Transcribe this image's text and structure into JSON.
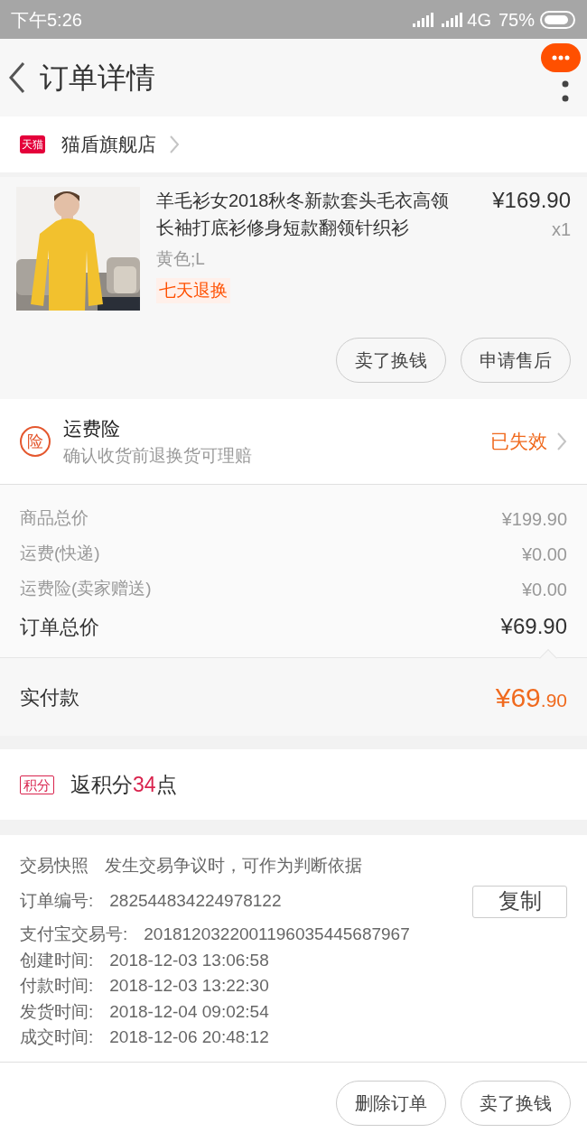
{
  "status_bar": {
    "time": "下午5:26",
    "network": "4G",
    "battery": "75%"
  },
  "header": {
    "title": "订单详情"
  },
  "shop": {
    "badge": "天猫",
    "name": "猫盾旗舰店"
  },
  "product": {
    "kind": "picture",
    "title": "羊毛衫女2018秋冬新款套头毛衣高领长袖打底衫修身短款翻领针织衫",
    "price": "¥169.90",
    "quantity": "x1",
    "sku": "黄色;L",
    "tag": "七天退换",
    "buttons": [
      "卖了换钱",
      "申请售后"
    ]
  },
  "insurance": {
    "icon_text": "险",
    "title": "运费险",
    "subtitle": "确认收货前退换货可理赔",
    "status": "已失效"
  },
  "price_rows": [
    {
      "kind": "minor",
      "label": "商品总价",
      "value": "¥199.90"
    },
    {
      "kind": "minor",
      "label": "运费(快递)",
      "value": "¥0.00"
    },
    {
      "kind": "minor",
      "label": "运费险(卖家赠送)",
      "value": "¥0.00"
    },
    {
      "kind": "total",
      "label": "订单总价",
      "value": "¥69.90"
    }
  ],
  "paid": {
    "label": "实付款",
    "value_main": "¥69",
    "value_decimal": ".90"
  },
  "points": {
    "badge": "积分",
    "text_before": "返积分",
    "amount": "34",
    "text_after": "点"
  },
  "order_info": {
    "snapshot_label": "交易快照",
    "snapshot_note": "发生交易争议时，可作为判断依据",
    "copy_button": "复制",
    "rows": [
      {
        "label": "订单编号:",
        "value": "282544834224978122"
      },
      {
        "label": "支付宝交易号:",
        "value": "2018120322001196035445687967"
      },
      {
        "label": "创建时间:",
        "value": "2018-12-03 13:06:58"
      },
      {
        "label": "付款时间:",
        "value": "2018-12-03 13:22:30"
      },
      {
        "label": "发货时间:",
        "value": "2018-12-04 09:02:54"
      },
      {
        "label": "成交时间:",
        "value": "2018-12-06 20:48:12"
      }
    ]
  },
  "footer_buttons": [
    "删除订单",
    "卖了换钱"
  ]
}
